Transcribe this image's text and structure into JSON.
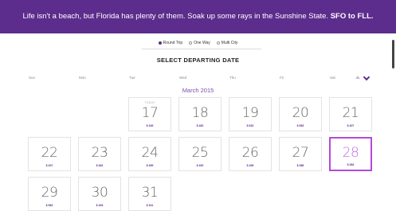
{
  "banner": {
    "text": "Life isn't a beach, but Florida has plenty of them. Soak up some rays in the Sunshine State.",
    "route": "SFO to FLL."
  },
  "trip_options": [
    {
      "label": "Round Trip",
      "selected": true
    },
    {
      "label": "One Way",
      "selected": false
    },
    {
      "label": "Multi City",
      "selected": false
    }
  ],
  "heading": "SELECT DEPARTING DATE",
  "days_of_week": [
    "Sun",
    "Mon",
    "Tue",
    "Wed",
    "Thu",
    "Fri",
    "Sat"
  ],
  "month": "March 2015",
  "calendar": {
    "week1": [
      {
        "day": "17",
        "price": "$ 349",
        "tag": "TODAY"
      },
      {
        "day": "18",
        "price": "$ 462"
      },
      {
        "day": "19",
        "price": "$ 632"
      },
      {
        "day": "20",
        "price": "$ 563"
      },
      {
        "day": "21",
        "price": "$ 407"
      }
    ],
    "week2": [
      {
        "day": "22",
        "price": "$ 407"
      },
      {
        "day": "23",
        "price": "$ 462"
      },
      {
        "day": "24",
        "price": "$ 459"
      },
      {
        "day": "25",
        "price": "$ 400"
      },
      {
        "day": "26",
        "price": "$ 459"
      },
      {
        "day": "27",
        "price": "$ 386"
      },
      {
        "day": "28",
        "price": "$ 384",
        "selected": true
      }
    ],
    "week3": [
      {
        "day": "29",
        "price": "$ 563"
      },
      {
        "day": "30",
        "price": "$ 263"
      },
      {
        "day": "31",
        "price": "$ 341"
      }
    ]
  },
  "colors": {
    "brand": "#5c2d8c",
    "selected_border": "#b44ad8",
    "month_text": "#7b4db0"
  },
  "icons": {
    "prev": "chevron-up-icon",
    "next": "chevron-down-icon"
  }
}
